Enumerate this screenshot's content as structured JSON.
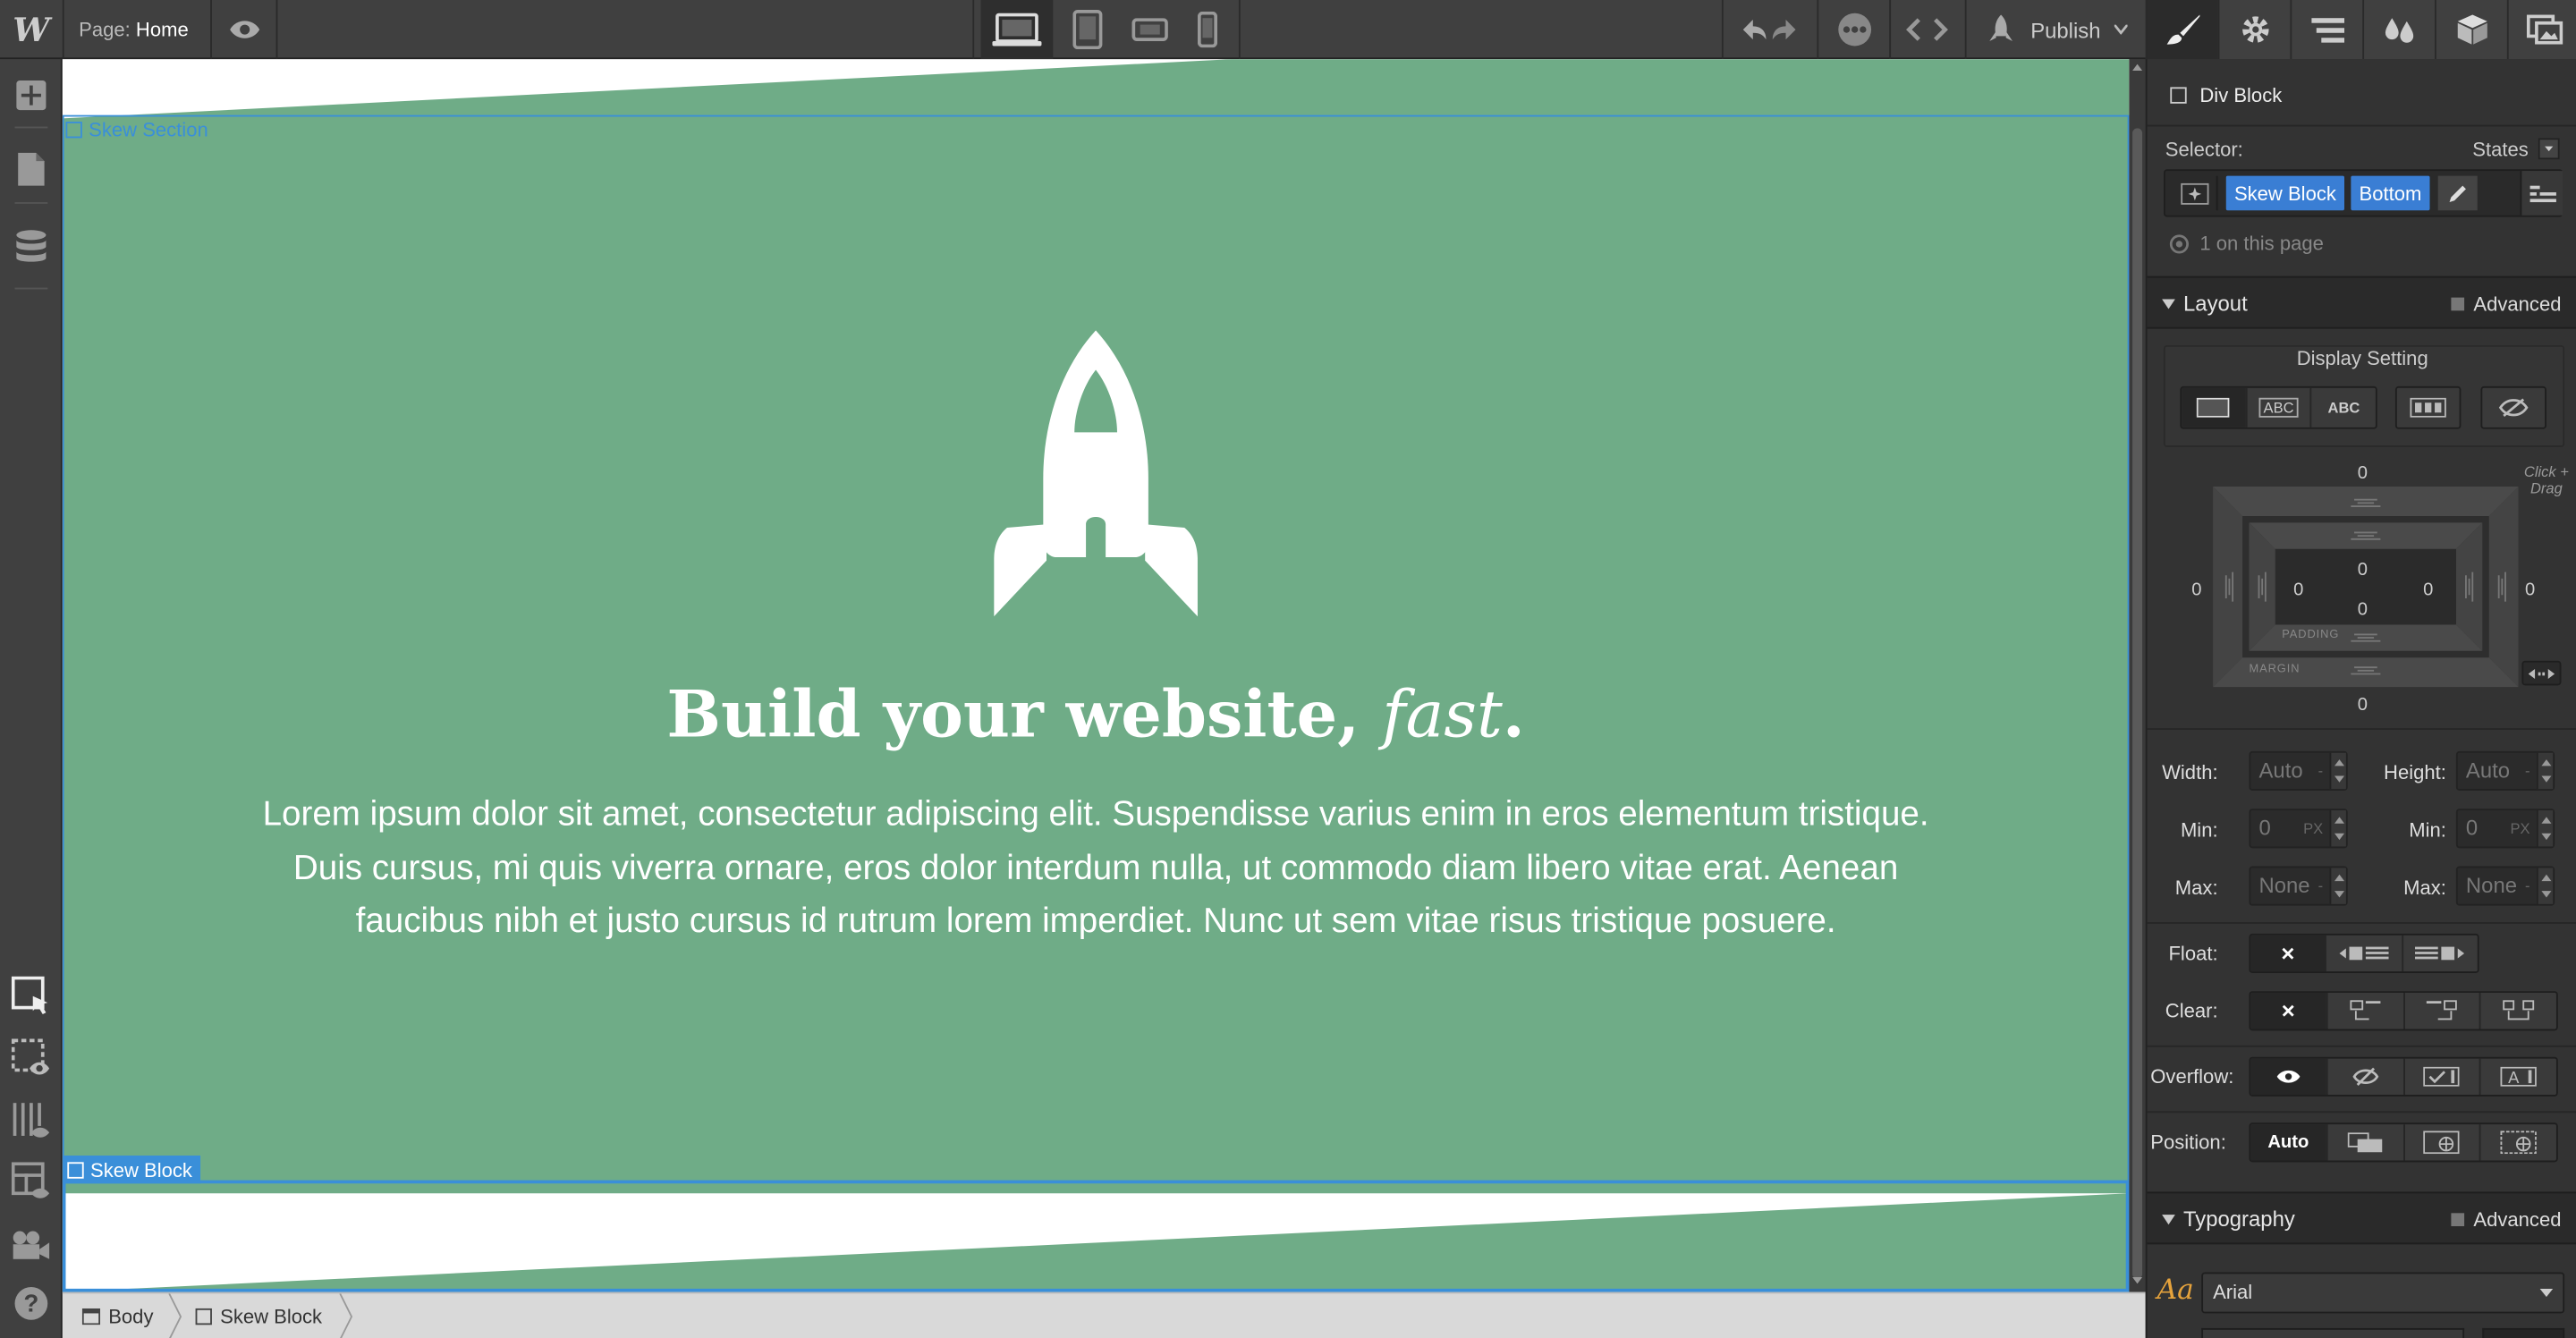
{
  "topbar": {
    "logo": "W",
    "page_prefix": "Page:",
    "page_name": "Home",
    "publish_label": "Publish"
  },
  "canvas": {
    "section_label": "Skew Section",
    "block_label": "Skew Block",
    "hero_title_prefix": "Build your website, ",
    "hero_title_emphasis": "fast",
    "hero_title_suffix": ".",
    "hero_body": "Lorem ipsum dolor sit amet, consectetur adipiscing elit. Suspendisse varius enim in eros elementum tristique. Duis cursus, mi quis viverra ornare, eros dolor interdum nulla, ut commodo diam libero vitae erat. Aenean faucibus nibh et justo cursus id rutrum lorem imperdiet. Nunc ut sem vitae risus tristique posuere.",
    "green": "#6fac87"
  },
  "breadcrumb": [
    "Body",
    "Skew Block"
  ],
  "panel": {
    "element_type": "Div Block",
    "selector_label": "Selector:",
    "states_label": "States",
    "selector_tags": [
      "Skew Block",
      "Bottom"
    ],
    "on_page": "1 on this page",
    "layout": {
      "title": "Layout",
      "advanced": "Advanced",
      "display_setting": "Display Setting",
      "display_abc1": "ABC",
      "display_abc2": "ABC",
      "box": {
        "margin_top": "0",
        "margin_bottom": "0",
        "margin_left": "0",
        "margin_right": "0",
        "padding_top": "0",
        "padding_bottom": "0",
        "padding_left": "0",
        "padding_right": "0",
        "padding_label": "PADDING",
        "margin_label": "MARGIN",
        "hint": "Click + Drag"
      },
      "width_label": "Width:",
      "width_value": "Auto",
      "height_label": "Height:",
      "height_value": "Auto",
      "min_label": "Min:",
      "min_w": "0",
      "min_h": "0",
      "px": "PX",
      "max_label": "Max:",
      "max_w": "None",
      "max_h": "None",
      "float_label": "Float:",
      "clear_label": "Clear:",
      "overflow_label": "Overflow:",
      "position_label": "Position:",
      "position_auto": "Auto"
    },
    "typography": {
      "title": "Typography",
      "advanced": "Advanced",
      "font_icon": "Aa",
      "font": "Arial"
    }
  }
}
